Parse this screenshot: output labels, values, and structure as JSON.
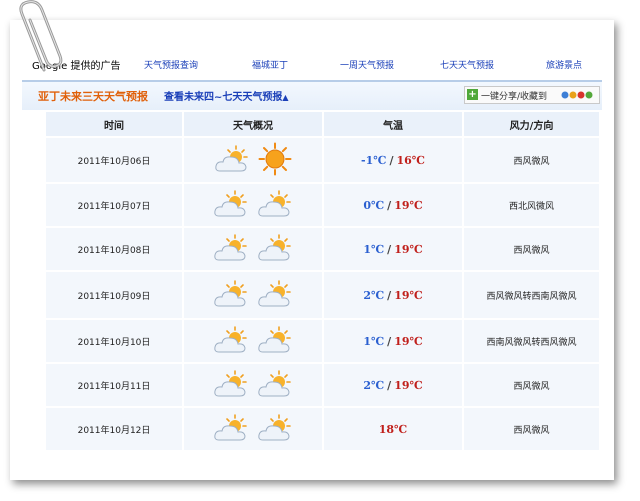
{
  "ads": {
    "brand": "Google 提供的广告",
    "links": [
      "天气预报查询",
      "福城亚丁",
      "一周天气预报",
      "七天天气预报",
      "旅游景点"
    ]
  },
  "title": {
    "main": "亚丁未来三天天气预报",
    "sub": "查看未来四~七天天气预报",
    "sub_arrow": "▲",
    "share": "一键分享/收藏到"
  },
  "table": {
    "headers": [
      "时间",
      "天气概况",
      "气温",
      "风力/方向"
    ],
    "rows": [
      {
        "date": "2011年10月06日",
        "icons": [
          "partly-cloudy-icon",
          "sun-icon"
        ],
        "low": "-1℃",
        "high": "16℃",
        "wind": "西风微风"
      },
      {
        "date": "2011年10月07日",
        "icons": [
          "partly-cloudy-icon",
          "partly-cloudy-icon"
        ],
        "low": "0℃",
        "high": "19℃",
        "wind": "西北风微风"
      },
      {
        "date": "2011年10月08日",
        "icons": [
          "partly-cloudy-icon",
          "partly-cloudy-icon"
        ],
        "low": "1℃",
        "high": "19℃",
        "wind": "西风微风"
      },
      {
        "date": "2011年10月09日",
        "icons": [
          "partly-cloudy-icon",
          "partly-cloudy-icon"
        ],
        "low": "2℃",
        "high": "19℃",
        "wind": "西风微风转西南风微风"
      },
      {
        "date": "2011年10月10日",
        "icons": [
          "partly-cloudy-icon",
          "partly-cloudy-icon"
        ],
        "low": "1℃",
        "high": "19℃",
        "wind": "西南风微风转西风微风"
      },
      {
        "date": "2011年10月11日",
        "icons": [
          "partly-cloudy-icon",
          "partly-cloudy-icon"
        ],
        "low": "2℃",
        "high": "19℃",
        "wind": "西风微风"
      },
      {
        "date": "2011年10月12日",
        "icons": [
          "partly-cloudy-icon",
          "partly-cloudy-icon"
        ],
        "low": "",
        "high": "18℃",
        "wind": "西风微风"
      }
    ]
  },
  "colors": {
    "title_orange": "#e0600a",
    "link_blue": "#1a3fb8",
    "temp_low": "#2a5fd0",
    "temp_high": "#c0201c"
  }
}
